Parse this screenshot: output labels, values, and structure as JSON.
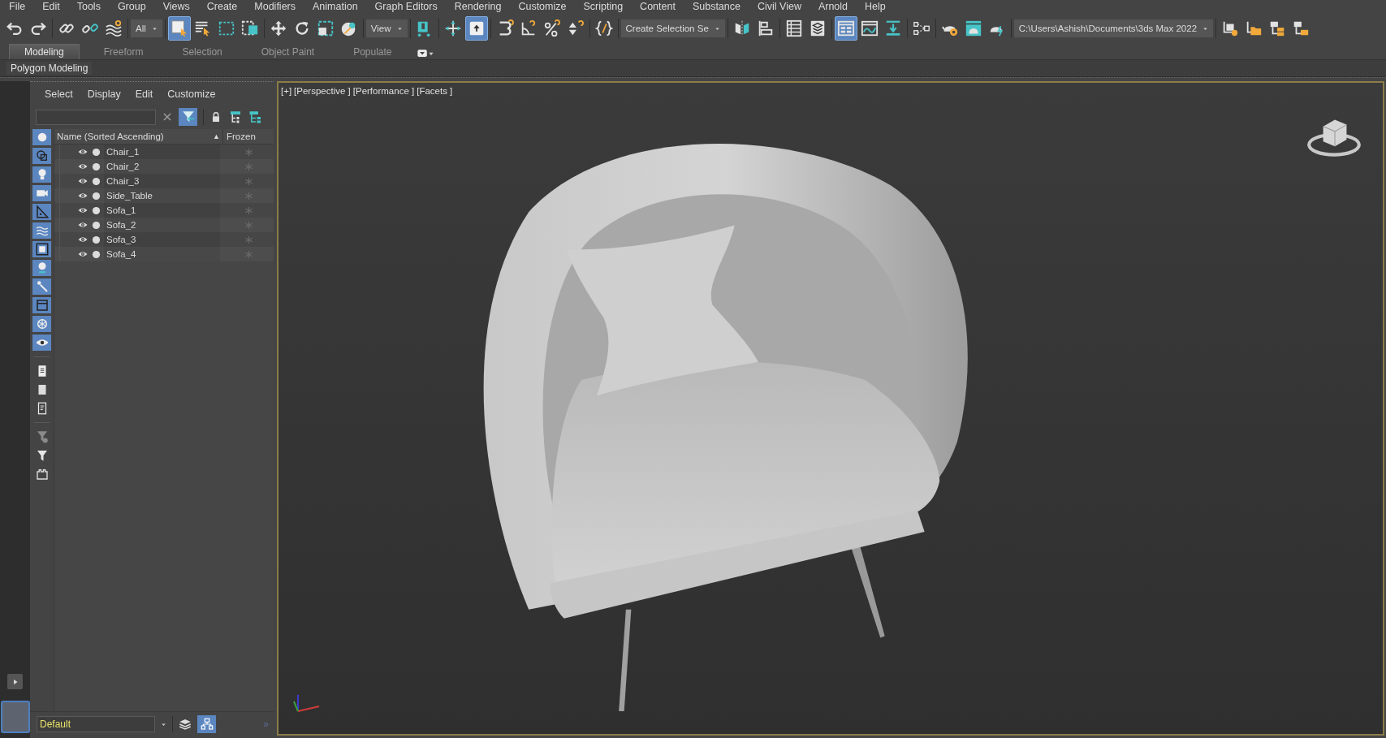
{
  "menu_bar": {
    "items": [
      "File",
      "Edit",
      "Tools",
      "Group",
      "Views",
      "Create",
      "Modifiers",
      "Animation",
      "Graph Editors",
      "Rendering",
      "Customize",
      "Scripting",
      "Content",
      "Substance",
      "Civil View",
      "Arnold",
      "Help"
    ]
  },
  "toolbar": {
    "items": [
      {
        "kind": "icon",
        "selected": false
      },
      {
        "kind": "icon",
        "selected": false
      },
      {
        "kind": "icon",
        "selected": false
      },
      {
        "kind": "icon",
        "selected": false
      },
      {
        "kind": "icon",
        "selected": false
      },
      {
        "kind": "dropdown",
        "value": "All"
      },
      {
        "kind": "icon",
        "selected": true
      },
      {
        "kind": "icon",
        "selected": false
      },
      {
        "kind": "icon",
        "selected": false
      },
      {
        "kind": "icon",
        "selected": false
      },
      {
        "kind": "icon",
        "selected": false
      },
      {
        "kind": "icon",
        "selected": false
      },
      {
        "kind": "icon",
        "selected": false
      },
      {
        "kind": "icon",
        "selected": false
      },
      {
        "kind": "dropdown",
        "value": "View"
      },
      {
        "kind": "icon",
        "selected": false
      },
      {
        "kind": "icon",
        "selected": false
      },
      {
        "kind": "icon",
        "selected": true
      },
      {
        "kind": "icon",
        "selected": false
      },
      {
        "kind": "icon",
        "selected": false
      },
      {
        "kind": "icon",
        "selected": false
      },
      {
        "kind": "icon",
        "selected": false
      },
      {
        "kind": "icon",
        "selected": false
      },
      {
        "kind": "dropdown",
        "value": "Create Selection Se"
      },
      {
        "kind": "icon",
        "selected": false
      },
      {
        "kind": "icon",
        "selected": false
      },
      {
        "kind": "icon",
        "selected": false
      },
      {
        "kind": "icon",
        "selected": false
      },
      {
        "kind": "icon",
        "selected": true
      },
      {
        "kind": "icon",
        "selected": false
      },
      {
        "kind": "icon",
        "selected": false
      },
      {
        "kind": "icon",
        "selected": false
      },
      {
        "kind": "icon",
        "selected": false
      },
      {
        "kind": "icon",
        "selected": false
      },
      {
        "kind": "icon",
        "selected": false
      },
      {
        "kind": "dropdown",
        "value": "C:\\Users\\Ashish\\Documents\\3ds Max 2022"
      },
      {
        "kind": "icon",
        "selected": false
      },
      {
        "kind": "icon",
        "selected": false
      },
      {
        "kind": "icon",
        "selected": false
      },
      {
        "kind": "icon",
        "selected": false
      }
    ]
  },
  "ribbon": {
    "tabs": [
      {
        "label": "Modeling",
        "selected": true
      },
      {
        "label": "Freeform",
        "selected": false
      },
      {
        "label": "Selection",
        "selected": false
      },
      {
        "label": "Object Paint",
        "selected": false
      },
      {
        "label": "Populate",
        "selected": false
      }
    ],
    "panel_label": "Polygon Modeling"
  },
  "scene_explorer": {
    "menu": [
      "Select",
      "Display",
      "Edit",
      "Customize"
    ],
    "filter_toggle": {
      "selected": true
    },
    "filter_buttons": [
      {
        "selected": true
      },
      {
        "selected": true
      },
      {
        "selected": true
      },
      {
        "selected": true
      },
      {
        "selected": true
      },
      {
        "selected": true
      },
      {
        "selected": true
      },
      {
        "selected": true
      },
      {
        "selected": true
      },
      {
        "selected": true
      },
      {
        "selected": true
      },
      {
        "selected": true
      },
      {
        "selected": false
      },
      {
        "selected": false
      },
      {
        "selected": false
      },
      {
        "selected": false
      },
      {
        "selected": false
      },
      {
        "selected": false
      }
    ],
    "columns": [
      {
        "label": "Name (Sorted Ascending)",
        "sort_indicator": "▲"
      },
      {
        "label": "Frozen"
      }
    ],
    "rows": [
      {
        "name": "Chair_1",
        "visible": true,
        "frozen": false
      },
      {
        "name": "Chair_2",
        "visible": true,
        "frozen": false
      },
      {
        "name": "Chair_3",
        "visible": true,
        "frozen": false
      },
      {
        "name": "Side_Table",
        "visible": true,
        "frozen": false
      },
      {
        "name": "Sofa_1",
        "visible": true,
        "frozen": false
      },
      {
        "name": "Sofa_2",
        "visible": true,
        "frozen": false
      },
      {
        "name": "Sofa_3",
        "visible": true,
        "frozen": false
      },
      {
        "name": "Sofa_4",
        "visible": true,
        "frozen": false
      }
    ],
    "layer_field": {
      "value": "Default"
    },
    "hierarchy_toggle": {
      "selected": true
    },
    "expand_mark": "»"
  },
  "viewport": {
    "labels": [
      "[+]",
      "[Perspective ]",
      "[Performance ]",
      "[Facets ]"
    ],
    "kind": "picture"
  }
}
